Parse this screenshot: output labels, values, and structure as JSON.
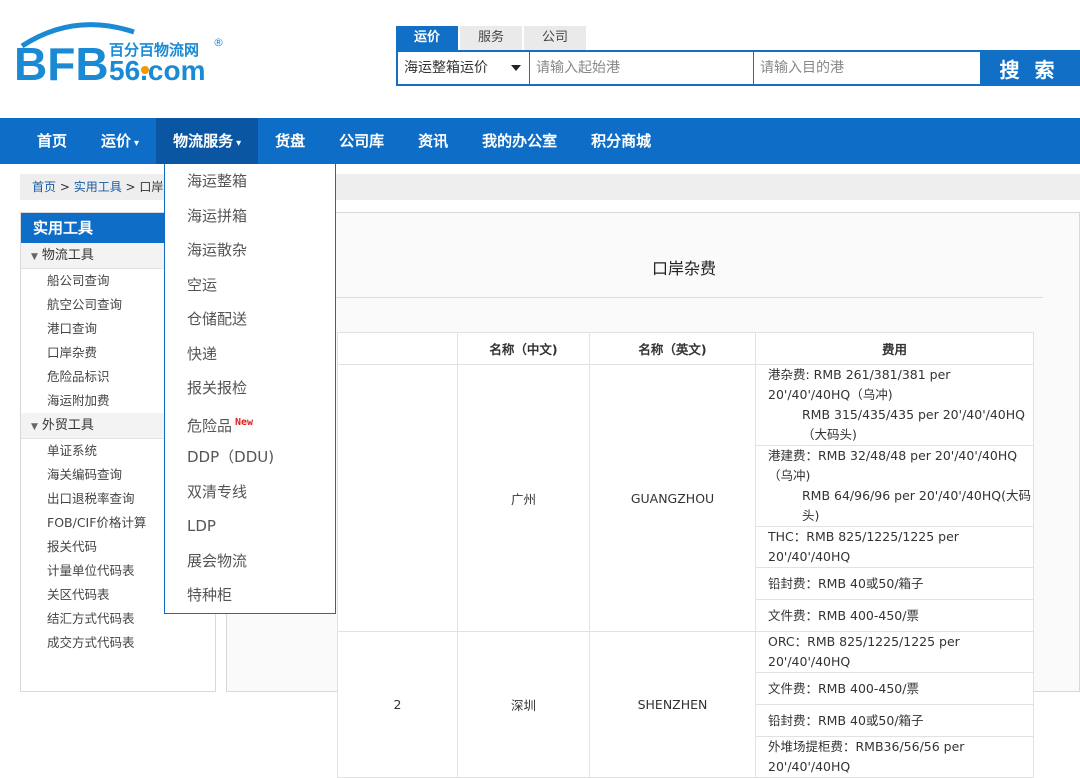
{
  "logo": {
    "brand": "BFB",
    "cn_name": "百分百物流网",
    "domain": "56.com",
    "registered": "®"
  },
  "search": {
    "tabs": [
      "运价",
      "服务",
      "公司"
    ],
    "active_tab": 0,
    "selected_type": "海运整箱运价",
    "origin_placeholder": "请输入起始港",
    "dest_placeholder": "请输入目的港",
    "button_label": "搜 索"
  },
  "nav": {
    "items": [
      {
        "label": "首页"
      },
      {
        "label": "运价",
        "arrow": "▾"
      },
      {
        "label": "物流服务",
        "arrow": "▾"
      },
      {
        "label": "货盘"
      },
      {
        "label": "公司库"
      },
      {
        "label": "资讯"
      },
      {
        "label": "我的办公室"
      },
      {
        "label": "积分商城"
      }
    ]
  },
  "breadcrumb": {
    "home": "首页",
    "sep": " > ",
    "tools": "实用工具",
    "current": "口岸"
  },
  "sidebar": {
    "title": "实用工具",
    "group1": "物流工具",
    "group1_items": [
      "船公司查询",
      "航空公司查询",
      "港口查询",
      "口岸杂费",
      "危险品标识",
      "海运附加费"
    ],
    "group2": "外贸工具",
    "group2_items": [
      "单证系统",
      "海关编码查询",
      "出口退税率查询",
      "FOB/CIF价格计算",
      "报关代码",
      "计量单位代码表",
      "关区代码表",
      "结汇方式代码表",
      "成交方式代码表"
    ]
  },
  "main": {
    "title": "口岸杂费",
    "headers": {
      "cn": "名称（中文)",
      "en": "名称（英文)",
      "fee": "费用"
    },
    "rows": [
      {
        "num": "",
        "cn": "广州",
        "en": "GUANGZHOU",
        "fees": [
          [
            "港杂费: RMB 261/381/381 per 20'/40'/40HQ（乌冲)",
            "RMB 315/435/435 per 20'/40'/40HQ（大码头)"
          ],
          [
            "港建费：RMB 32/48/48 per 20'/40'/40HQ（乌冲)",
            "RMB 64/96/96 per 20'/40'/40HQ(大码头)"
          ],
          [
            "THC：RMB 825/1225/1225 per 20'/40'/40HQ"
          ],
          [
            "铅封费：RMB 40或50/箱子"
          ],
          [
            "文件费：RMB 400-450/票"
          ]
        ]
      },
      {
        "num": "2",
        "cn": "深圳",
        "en": "SHENZHEN",
        "fees": [
          [
            "ORC：RMB 825/1225/1225 per 20'/40'/40HQ"
          ],
          [
            "文件费：RMB 400-450/票"
          ],
          [
            "铅封费：RMB 40或50/箱子"
          ],
          [
            "外堆场提柜费：RMB36/56/56 per 20'/40'/40HQ"
          ]
        ]
      }
    ]
  },
  "dropdown": {
    "items": [
      "海运整箱",
      "海运拼箱",
      "海运散杂",
      "空运",
      "仓储配送",
      "快递",
      "报关报检",
      "危险品",
      "DDP（DDU)",
      "双清专线",
      "LDP",
      "展会物流",
      "特种柜"
    ],
    "new_badge": "New"
  },
  "colors": {
    "primary": "#0d6dc7",
    "nav_active": "#0a56a3",
    "logo_blue": "#1a8ad4",
    "logo_orange": "#f39800"
  }
}
